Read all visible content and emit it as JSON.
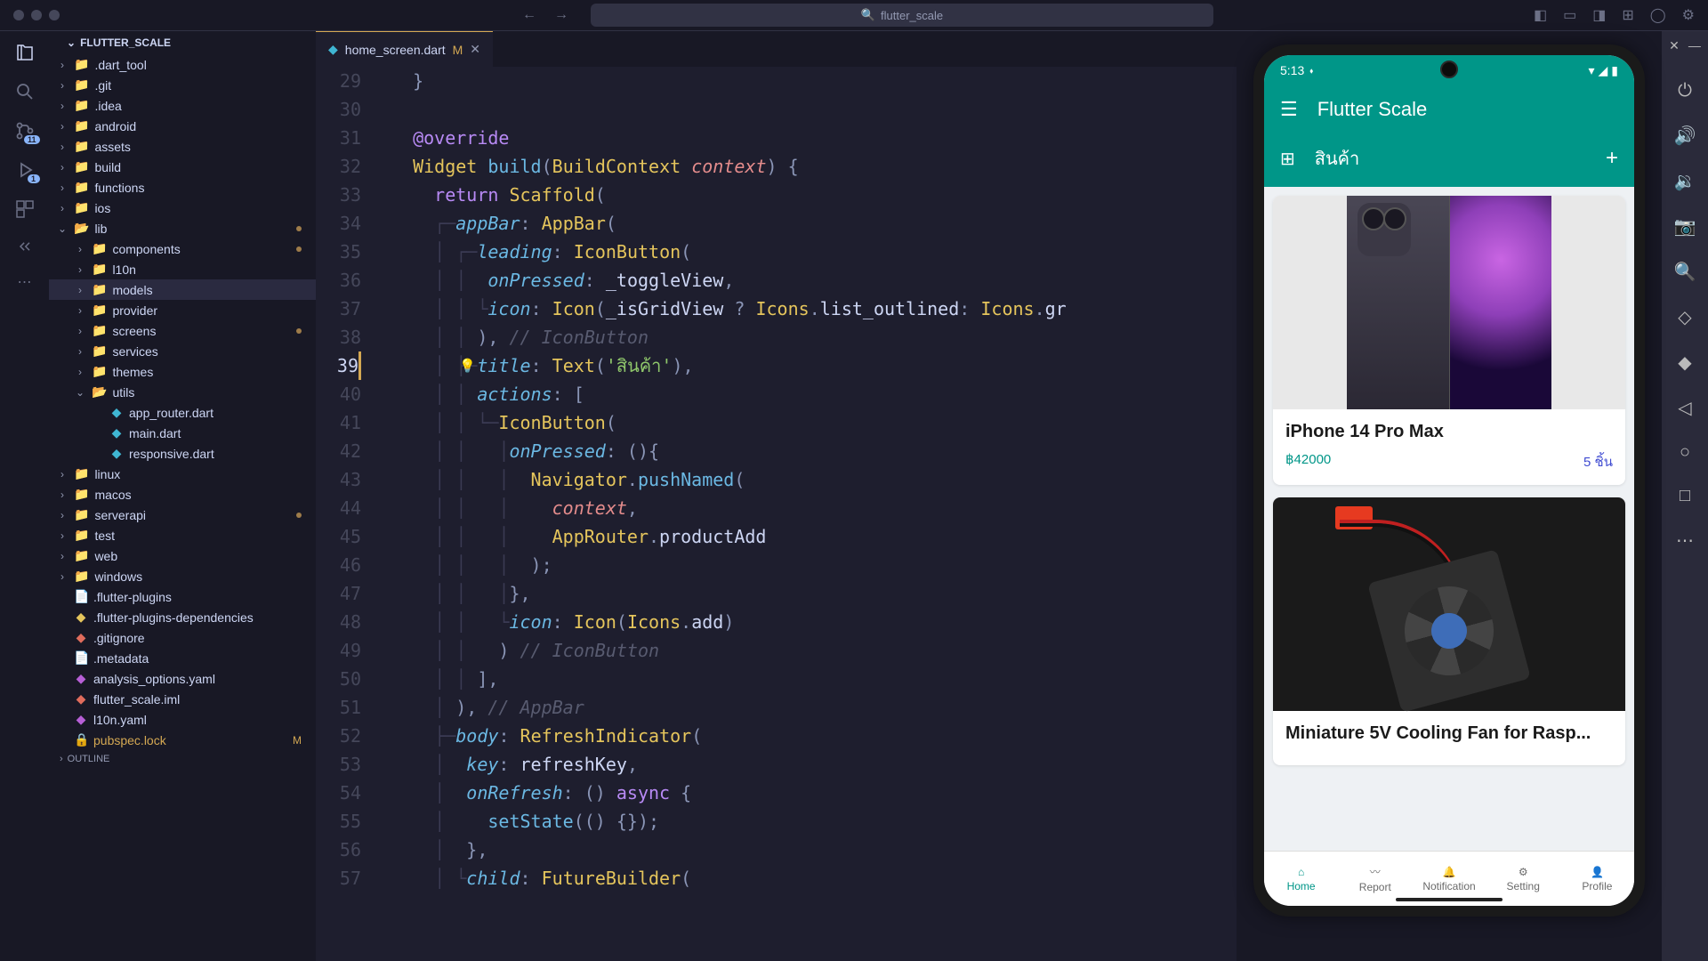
{
  "titlebar": {
    "search": "flutter_scale"
  },
  "activity": {
    "git_badge": "11",
    "debug_badge": "1"
  },
  "sidebar": {
    "header": "FLUTTER_SCALE",
    "f0": ".dart_tool",
    "f1": ".git",
    "f2": ".idea",
    "f3": "android",
    "f4": "assets",
    "f5": "build",
    "f6": "functions",
    "f7": "ios",
    "f8": "lib",
    "f8_0": "components",
    "f8_1": "l10n",
    "f8_2": "models",
    "f8_3": "provider",
    "f8_4": "screens",
    "f8_5": "services",
    "f8_6": "themes",
    "f8_7": "utils",
    "f8_f0": "app_router.dart",
    "f8_f1": "main.dart",
    "f8_f2": "responsive.dart",
    "f9": "linux",
    "f10": "macos",
    "f11": "serverapi",
    "f12": "test",
    "f13": "web",
    "f14": "windows",
    "file0": ".flutter-plugins",
    "file1": ".flutter-plugins-dependencies",
    "file2": ".gitignore",
    "file3": ".metadata",
    "file4": "analysis_options.yaml",
    "file5": "flutter_scale.iml",
    "file6": "l10n.yaml",
    "file7": "pubspec.lock",
    "outline": "OUTLINE"
  },
  "tab": {
    "name": "home_screen.dart",
    "status": "M"
  },
  "code": {
    "lines": [
      "29",
      "30",
      "31",
      "32",
      "33",
      "34",
      "35",
      "36",
      "37",
      "38",
      "39",
      "40",
      "41",
      "42",
      "43",
      "44",
      "45",
      "46",
      "47",
      "48",
      "49",
      "50",
      "51",
      "52",
      "53",
      "54",
      "55",
      "56",
      "57"
    ],
    "l29_brace": "}",
    "l31_override": "@override",
    "l32_widget": "Widget",
    "l32_build": "build",
    "l32_bc": "BuildContext",
    "l32_ctx": "context",
    "l33_return": "return",
    "l33_scaffold": "Scaffold",
    "l34_appbar": "appBar",
    "l34_AppBar": "AppBar",
    "l35_leading": "leading",
    "l35_iconbtn": "IconButton",
    "l36_onpressed": "onPressed",
    "l36_toggle": "_toggleView",
    "l37_icon": "icon",
    "l37_Icon": "Icon",
    "l37_isgrid": "_isGridView",
    "l37_icons": "Icons",
    "l37_list": "list_outlined",
    "l37_icons2": "Icons",
    "l37_gr": "gr",
    "l38_comment": "// IconButton",
    "l39_title": "title",
    "l39_text": "Text",
    "l39_str": "'สินค้า'",
    "l40_actions": "actions",
    "l41_iconbtn": "IconButton",
    "l42_onpressed": "onPressed",
    "l43_nav": "Navigator",
    "l43_push": "pushNamed",
    "l44_ctx": "context",
    "l45_router": "AppRouter",
    "l45_add": "productAdd",
    "l48_icon": "icon",
    "l48_Icon": "Icon",
    "l48_icons": "Icons",
    "l48_add": "add",
    "l49_comment": "// IconButton",
    "l51_comment": "// AppBar",
    "l52_body": "body",
    "l52_refresh": "RefreshIndicator",
    "l53_key": "key",
    "l53_refreshkey": "refreshKey",
    "l54_onrefresh": "onRefresh",
    "l54_async": "async",
    "l55_setstate": "setState",
    "l57_child": "child",
    "l57_future": "FutureBuilder"
  },
  "emulator": {
    "time": "5:13",
    "app_title": "Flutter Scale",
    "subtitle": "สินค้า",
    "product1": {
      "name": "iPhone 14 Pro Max",
      "price": "฿42000",
      "qty": "5 ชิ้น"
    },
    "product2": {
      "name": "Miniature 5V Cooling Fan for Rasp..."
    },
    "nav": {
      "home": "Home",
      "report": "Report",
      "notif": "Notification",
      "setting": "Setting",
      "profile": "Profile"
    }
  }
}
